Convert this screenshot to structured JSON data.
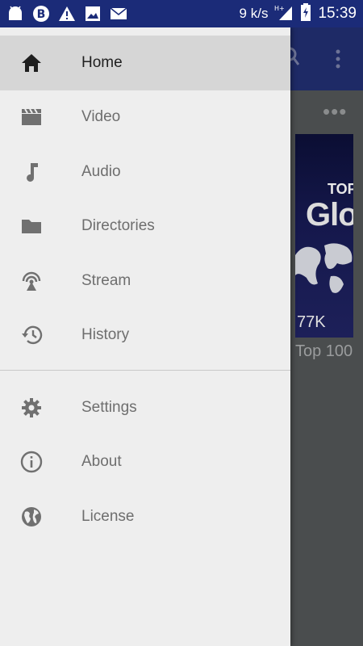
{
  "status_bar": {
    "speed": "9 k/s",
    "network": "H+",
    "time": "15:39",
    "icons": [
      "android-icon",
      "b-badge-icon",
      "warning-icon",
      "image-icon",
      "mail-icon"
    ]
  },
  "background_app": {
    "more_label": "•••",
    "thumb_top": "TOP",
    "thumb_big": "Glo",
    "thumb_count": "77K",
    "thumb_title": "Top 100"
  },
  "drawer": {
    "primary": [
      {
        "label": "Home",
        "icon": "home-icon",
        "active": true
      },
      {
        "label": "Video",
        "icon": "video-icon"
      },
      {
        "label": "Audio",
        "icon": "music-note-icon"
      },
      {
        "label": "Directories",
        "icon": "folder-icon"
      },
      {
        "label": "Stream",
        "icon": "stream-icon"
      },
      {
        "label": "History",
        "icon": "history-icon"
      }
    ],
    "secondary": [
      {
        "label": "Settings",
        "icon": "gear-icon"
      },
      {
        "label": "About",
        "icon": "info-icon"
      },
      {
        "label": "License",
        "icon": "globe-icon"
      }
    ]
  },
  "colors": {
    "status_bar_bg": "#1b2b78",
    "drawer_bg": "#eeeeee",
    "active_item_bg": "#d6d6d6",
    "active_text": "#1f1f1f",
    "item_text": "#6e6e6e",
    "icon_gray": "#707070"
  }
}
